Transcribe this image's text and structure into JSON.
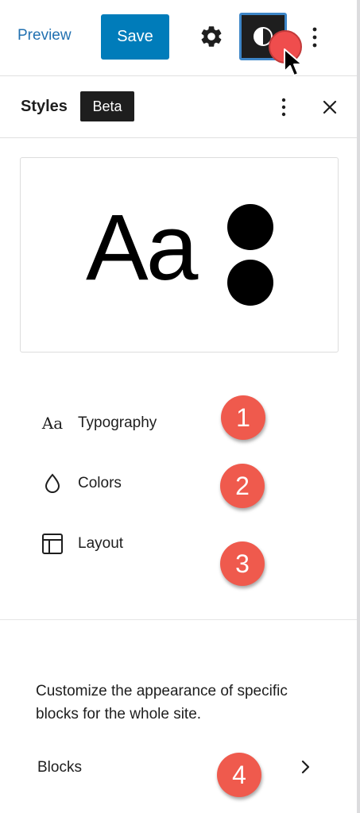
{
  "toolbar": {
    "preview_label": "Preview",
    "save_label": "Save"
  },
  "panel": {
    "title": "Styles",
    "badge": "Beta"
  },
  "preview_card": {
    "sample_text": "Aa"
  },
  "menu": [
    {
      "label": "Typography",
      "icon": "typography-icon",
      "icon_text": "Aa"
    },
    {
      "label": "Colors",
      "icon": "droplet-icon"
    },
    {
      "label": "Layout",
      "icon": "layout-icon"
    }
  ],
  "annotations": [
    "1",
    "2",
    "3",
    "4"
  ],
  "blocks": {
    "description": "Customize the appearance of specific blocks for the whole site.",
    "label": "Blocks"
  },
  "colors": {
    "accent": "#007cba",
    "link": "#2271b1",
    "annotation": "#ef5a4d",
    "dark": "#1e1e1e"
  }
}
